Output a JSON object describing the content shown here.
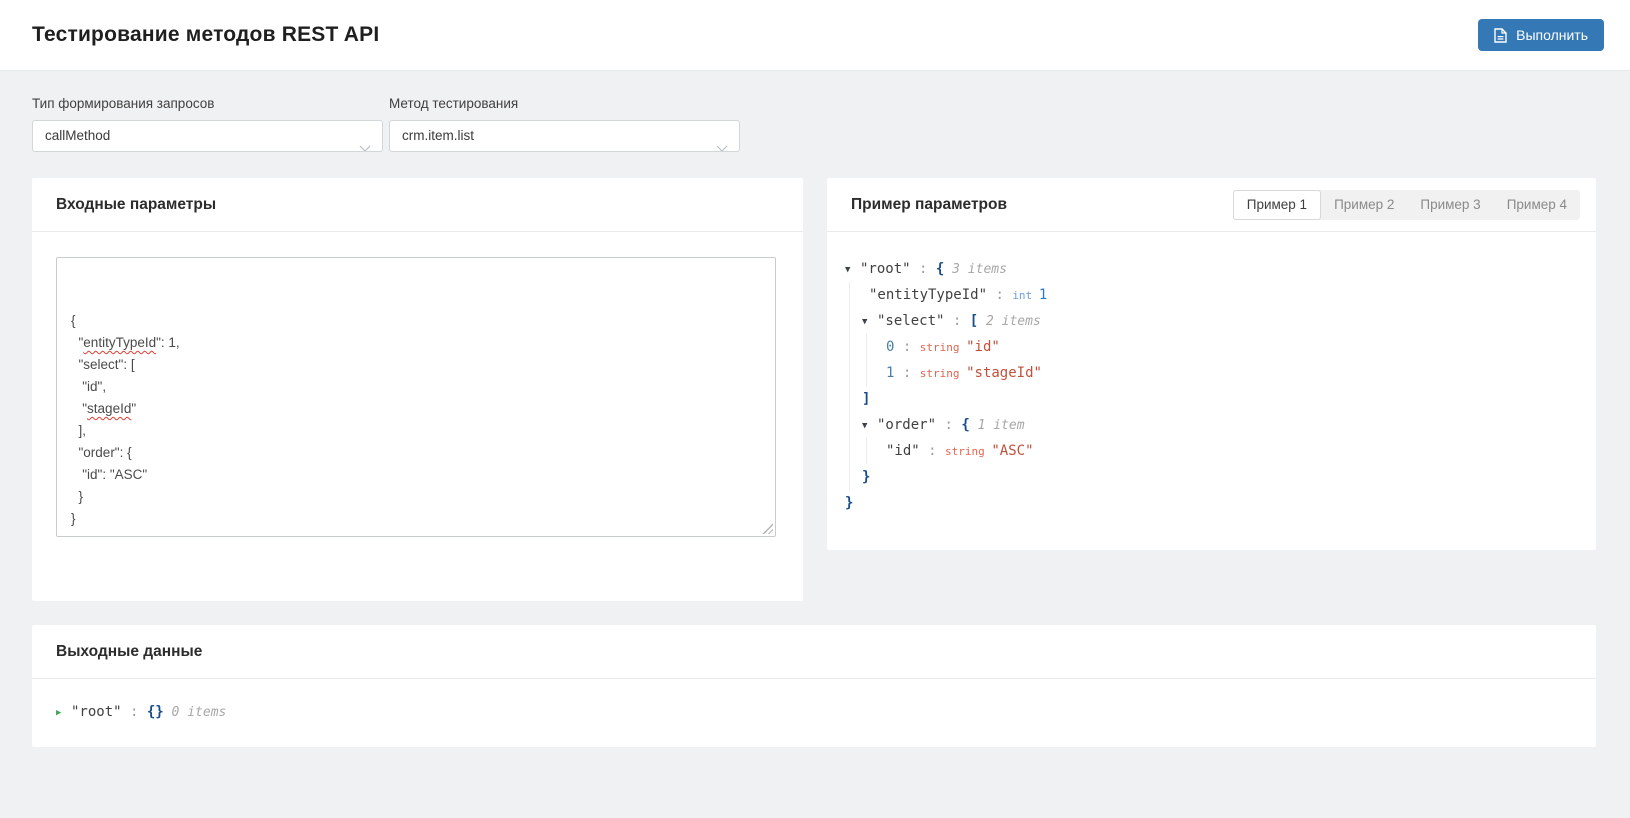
{
  "header": {
    "title": "Тестирование методов REST API",
    "execute_button": "Выполнить"
  },
  "form": {
    "request_type_label": "Тип формирования запросов",
    "request_type_value": "callMethod",
    "method_label": "Метод тестирования",
    "method_value": "crm.item.list"
  },
  "input_panel": {
    "title": "Входные параметры",
    "editor_lines": [
      [
        {
          "t": "{"
        }
      ],
      [
        {
          "t": "  \""
        },
        {
          "t": "entityTypeId",
          "misspelled": true
        },
        {
          "t": "\": 1,"
        }
      ],
      [
        {
          "t": "  \"select\": ["
        }
      ],
      [
        {
          "t": "   \"id\","
        }
      ],
      [
        {
          "t": "   \""
        },
        {
          "t": "stageId",
          "misspelled": true
        },
        {
          "t": "\""
        }
      ],
      [
        {
          "t": "  ],"
        }
      ],
      [
        {
          "t": "  \"order\": {"
        }
      ],
      [
        {
          "t": "   \"id\": \"ASC\""
        }
      ],
      [
        {
          "t": "  }"
        }
      ],
      [
        {
          "t": "}"
        }
      ]
    ]
  },
  "example_panel": {
    "title": "Пример параметров",
    "tabs": [
      {
        "label": "Пример 1",
        "active": true
      },
      {
        "label": "Пример 2",
        "active": false
      },
      {
        "label": "Пример 3",
        "active": false
      },
      {
        "label": "Пример 4",
        "active": false
      }
    ],
    "tree": {
      "arrow": true,
      "key": "\"root\"",
      "bracket": "{",
      "meta": "3 items",
      "close": "}",
      "children": [
        {
          "key": "\"entityTypeId\"",
          "type": "int",
          "value": "1"
        },
        {
          "arrow": true,
          "key": "\"select\"",
          "bracket": "[",
          "meta": "2 items",
          "close": "]",
          "children": [
            {
              "index": "0",
              "type": "string",
              "value": "\"id\""
            },
            {
              "index": "1",
              "type": "string",
              "value": "\"stageId\""
            }
          ]
        },
        {
          "arrow": true,
          "key": "\"order\"",
          "bracket": "{",
          "meta": "1 item",
          "close": "}",
          "children": [
            {
              "key": "\"id\"",
              "type": "string",
              "value": "\"ASC\""
            }
          ]
        }
      ]
    }
  },
  "output_panel": {
    "title": "Выходные данные",
    "tree": {
      "arrow": true,
      "collapsed": true,
      "key": "\"root\"",
      "bracket": "{}",
      "meta": "0 items"
    }
  },
  "colors": {
    "accent_blue": "#3478b6",
    "int_value_blue": "#2e7bce",
    "string_value_red": "#c0503a",
    "bracket_navy": "#1a4e8a",
    "collapsed_arrow_green": "#3fa75f",
    "page_background": "#f0f1f3"
  }
}
